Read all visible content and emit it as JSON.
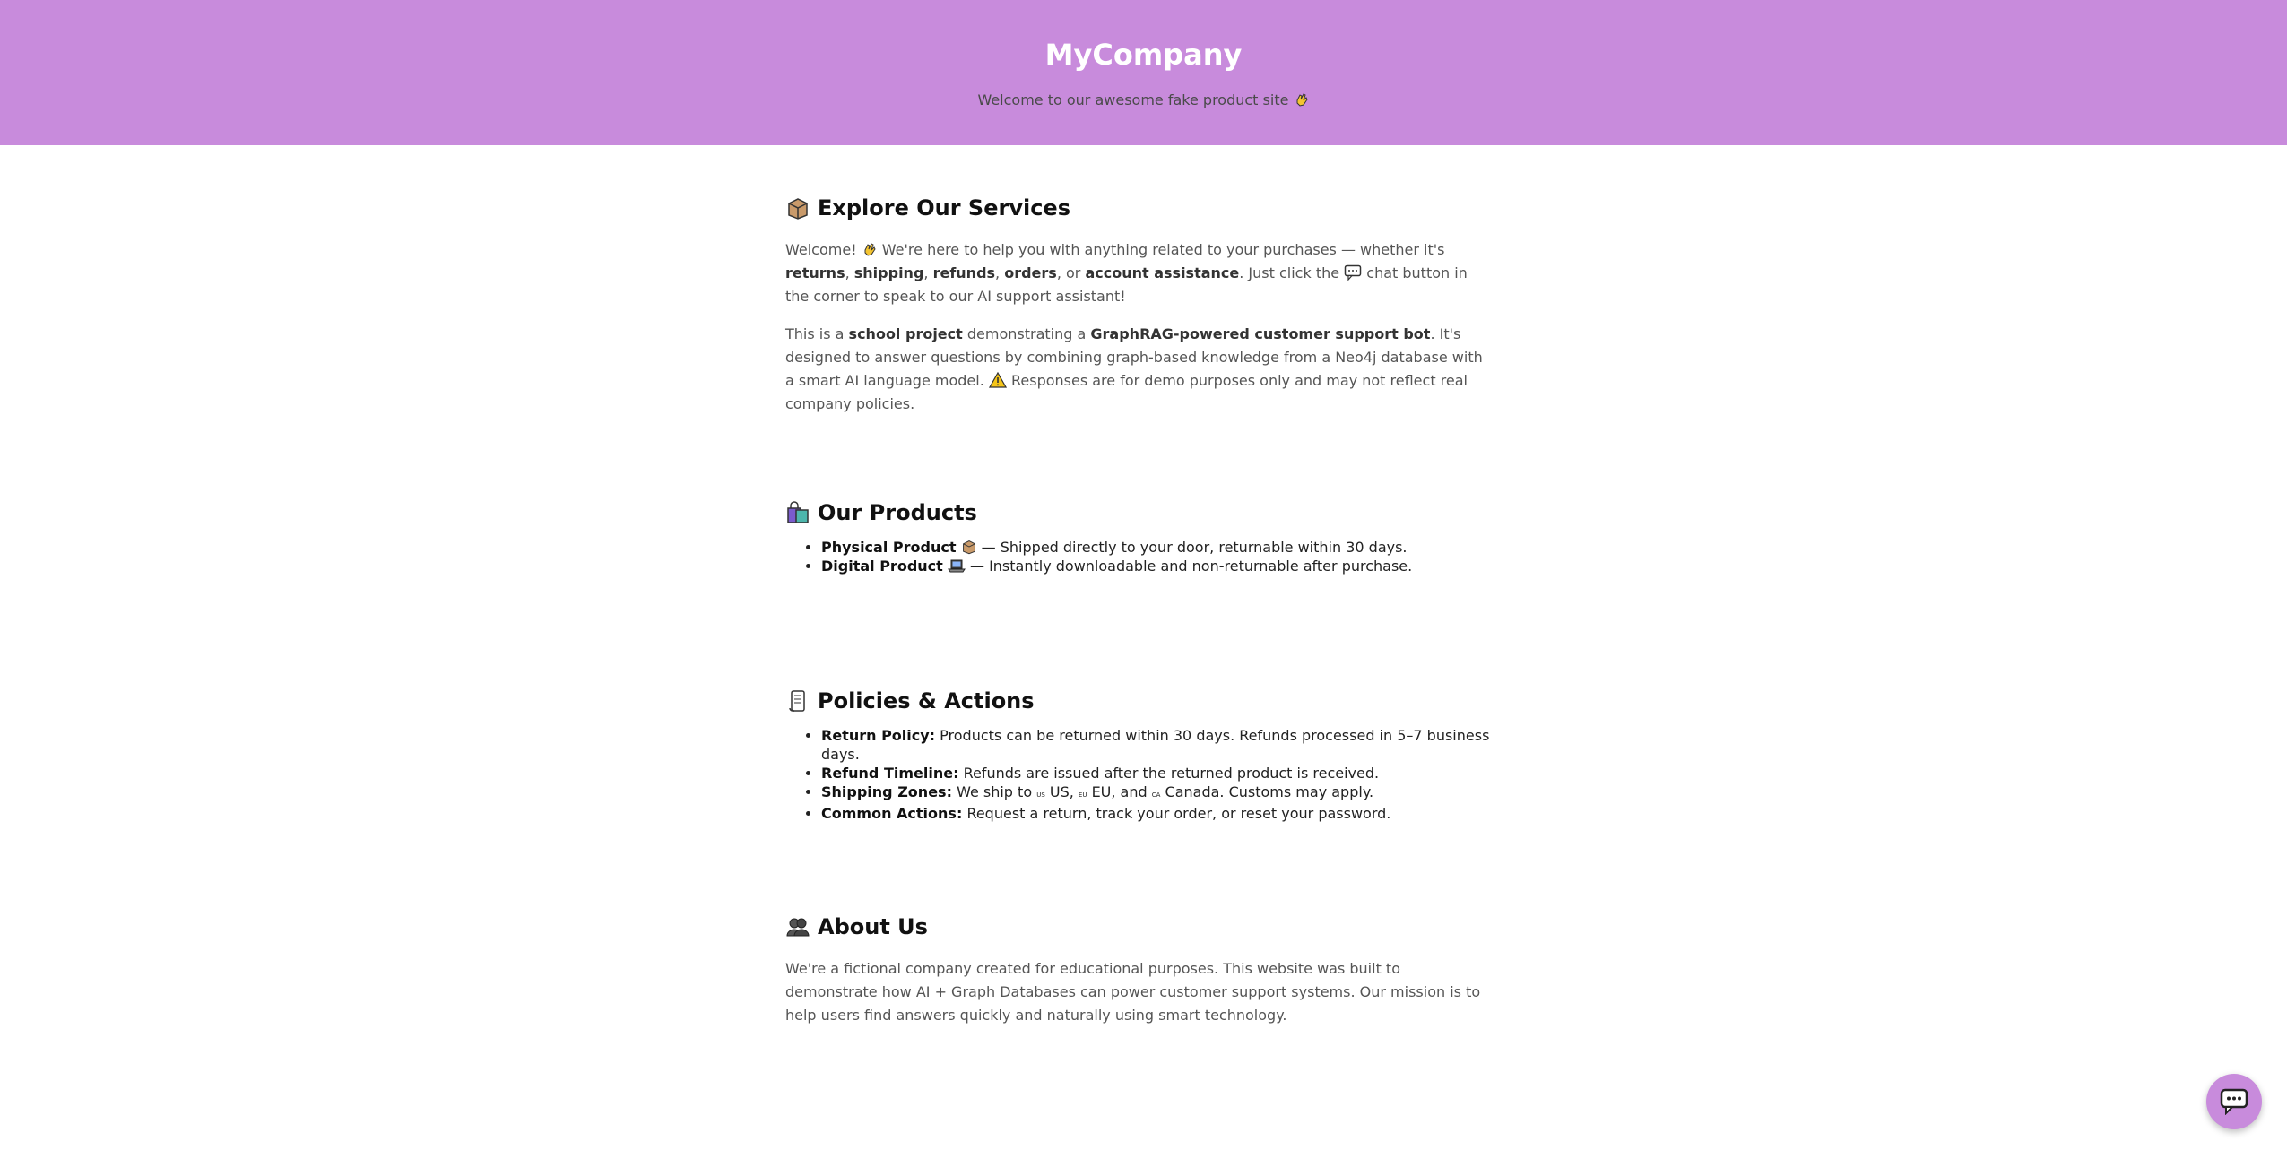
{
  "header": {
    "title": "MyCompany",
    "subtitle": "Welcome to our awesome fake product site",
    "bg_color": "#c88bdc"
  },
  "services": {
    "title": "Explore Our Services",
    "p1": {
      "t1": "Welcome!",
      "t2": "We're here to help you with anything related to your purchases — whether it's",
      "returns": "returns",
      "shipping": "shipping",
      "refunds": "refunds",
      "orders": "orders",
      "or": ", or",
      "account": "account assistance",
      "t3": ". Just click the",
      "t4": "chat button in the corner to speak to our AI support assistant!"
    },
    "p2": {
      "t1": "This is a",
      "school": "school project",
      "t2": "demonstrating a",
      "graphrag": "GraphRAG-powered customer support bot",
      "t3": ". It's designed to answer questions by combining graph-based knowledge from a Neo4j database with a smart AI language model.",
      "t4": "Responses are for demo purposes only and may not reflect real company policies."
    }
  },
  "products": {
    "title": "Our Products",
    "items": [
      {
        "name": "Physical Product",
        "desc": "— Shipped directly to your door, returnable within 30 days.",
        "icon": "box-icon"
      },
      {
        "name": "Digital Product",
        "desc": "— Instantly downloadable and non-returnable after purchase.",
        "icon": "laptop-icon"
      }
    ]
  },
  "policies": {
    "title": "Policies & Actions",
    "items": [
      {
        "label": "Return Policy:",
        "text": "Products can be returned within 30 days. Refunds processed in 5–7 business days."
      },
      {
        "label": "Refund Timeline:",
        "text": "Refunds are issued after the returned product is received."
      },
      {
        "label": "Shipping Zones:",
        "t1": "We ship to",
        "us": "us",
        "us_name": "US,",
        "eu": "eu",
        "eu_name": "EU, and",
        "ca": "ca",
        "ca_name": "Canada. Customs may apply."
      },
      {
        "label": "Common Actions:",
        "text": "Request a return, track your order, or reset your password."
      }
    ]
  },
  "about": {
    "title": "About Us",
    "text": "We're a fictional company created for educational purposes. This website was built to demonstrate how AI + Graph Databases can power customer support systems. Our mission is to help users find answers quickly and naturally using smart technology."
  },
  "chat": {
    "icon": "chat-bubble-icon"
  }
}
